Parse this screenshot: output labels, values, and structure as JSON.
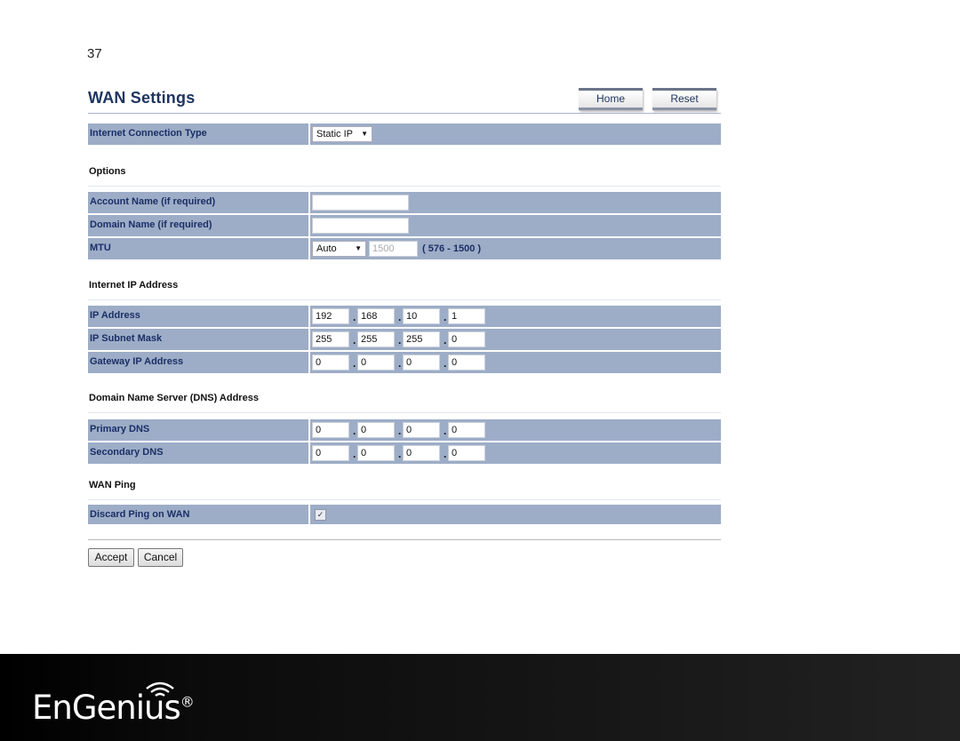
{
  "page_number": "37",
  "header": {
    "title": "WAN Settings",
    "home_label": "Home",
    "reset_label": "Reset"
  },
  "connection": {
    "label": "Internet Connection Type",
    "value": "Static IP"
  },
  "options": {
    "heading": "Options",
    "account": {
      "label": "Account Name (if required)",
      "value": ""
    },
    "domain": {
      "label": "Domain Name (if required)",
      "value": ""
    },
    "mtu": {
      "label": "MTU",
      "mode": "Auto",
      "value": "1500",
      "range": "( 576 - 1500 )"
    }
  },
  "internet_ip": {
    "heading": "Internet IP Address",
    "rows": [
      {
        "label": "IP Address",
        "octets": [
          "192",
          "168",
          "10",
          "1"
        ]
      },
      {
        "label": "IP Subnet Mask",
        "octets": [
          "255",
          "255",
          "255",
          "0"
        ]
      },
      {
        "label": "Gateway IP Address",
        "octets": [
          "0",
          "0",
          "0",
          "0"
        ]
      }
    ]
  },
  "dns": {
    "heading": "Domain Name Server (DNS) Address",
    "rows": [
      {
        "label": "Primary DNS",
        "octets": [
          "0",
          "0",
          "0",
          "0"
        ]
      },
      {
        "label": "Secondary DNS",
        "octets": [
          "0",
          "0",
          "0",
          "0"
        ]
      }
    ]
  },
  "wan_ping": {
    "heading": "WAN Ping",
    "label": "Discard Ping on WAN",
    "checked": true
  },
  "actions": {
    "accept": "Accept",
    "cancel": "Cancel"
  },
  "footer": {
    "logo_text": "EnGenius®"
  }
}
